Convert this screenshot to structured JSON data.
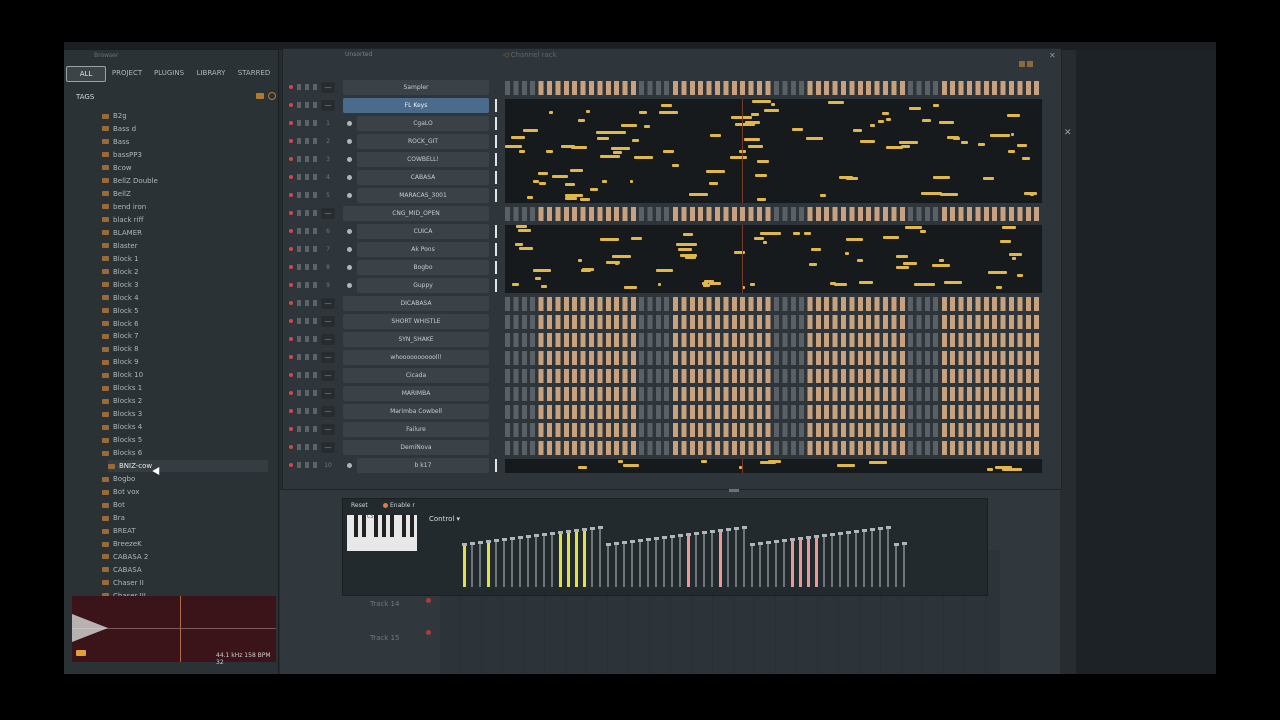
{
  "browser": {
    "title": "Browser",
    "tabs": [
      "ALL",
      "PROJECT",
      "PLUGINS",
      "LIBRARY",
      "STARRED"
    ],
    "tags_label": "TAGS",
    "items": [
      "B2g",
      "Bass d",
      "Bass",
      "bassPP3",
      "Bcow",
      "BellZ Double",
      "BellZ",
      "bend iron",
      "black riff",
      "BLAMER",
      "Blaster",
      "Block 1",
      "Block 2",
      "Block 3",
      "Block 4",
      "Block 5",
      "Block 6",
      "Block 7",
      "Block 8",
      "Block 9",
      "Block 10",
      "Blocks 1",
      "Blocks 2",
      "Blocks 3",
      "Blocks 4",
      "Blocks 5",
      "Blocks 6",
      "BNIZ-cow",
      "Bogbo",
      "Bot vox",
      "Bot",
      "Bra",
      "BREAT",
      "BreezeK",
      "CABASA 2",
      "CABASA",
      "Chaser II",
      "Chaser III"
    ],
    "selected_item": "BNIZ-cow",
    "preview_info": "44.1 kHz 158 BPM 32"
  },
  "channel_rack": {
    "title": "Channel rack",
    "filter": "Unsorted",
    "channels": [
      {
        "num": "",
        "name": "Sampler",
        "type": "pads"
      },
      {
        "num": "",
        "name": "FL Keys",
        "type": "piano",
        "selected": true
      },
      {
        "num": "1",
        "name": "CgaLO",
        "type": "piano"
      },
      {
        "num": "2",
        "name": "ROCK_GIT",
        "type": "piano"
      },
      {
        "num": "3",
        "name": "COWBELL!",
        "type": "piano"
      },
      {
        "num": "4",
        "name": "CABASA",
        "type": "piano"
      },
      {
        "num": "5",
        "name": "MARACAS_3001",
        "type": "piano"
      },
      {
        "num": "",
        "name": "CNG_MID_OPEN",
        "type": "pads"
      },
      {
        "num": "6",
        "name": "CUICA",
        "type": "piano"
      },
      {
        "num": "7",
        "name": "Ak Pons",
        "type": "piano"
      },
      {
        "num": "8",
        "name": "Bogbo",
        "type": "piano"
      },
      {
        "num": "9",
        "name": "Guppy",
        "type": "piano"
      },
      {
        "num": "",
        "name": "DICABASA",
        "type": "pads"
      },
      {
        "num": "",
        "name": "SHORT WHISTLE",
        "type": "pads"
      },
      {
        "num": "",
        "name": "SYN_SHAKE",
        "type": "pads"
      },
      {
        "num": "",
        "name": "whooooooooooll!",
        "type": "pads"
      },
      {
        "num": "",
        "name": "Cicada",
        "type": "pads"
      },
      {
        "num": "",
        "name": "MARIMBA",
        "type": "pads"
      },
      {
        "num": "",
        "name": "Marimba Cowbell",
        "type": "pads"
      },
      {
        "num": "",
        "name": "Failure",
        "type": "pads"
      },
      {
        "num": "",
        "name": "DemiNova",
        "type": "pads"
      },
      {
        "num": "10",
        "name": "b k17",
        "type": "piano"
      }
    ],
    "mute_label": "—"
  },
  "channel_settings": {
    "reset_label": "Reset",
    "enable_label": "Enable r",
    "control_label": "Control",
    "keyboard_label": "C5"
  },
  "playlist": {
    "tracks": [
      "Track 14",
      "Track 15"
    ]
  },
  "colors": {
    "accent": "#e0b84a",
    "pad_on": "#c8a27e",
    "selected_channel": "#4a6b8c"
  }
}
